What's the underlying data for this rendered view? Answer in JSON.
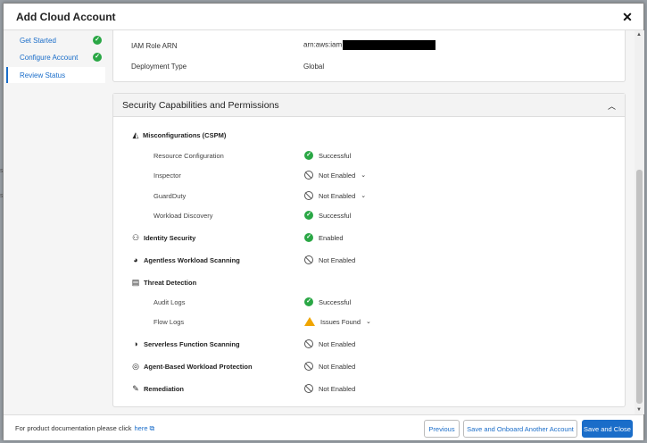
{
  "modal": {
    "title": "Add Cloud Account"
  },
  "sidebar": {
    "items": [
      {
        "label": "Get Started",
        "done": true
      },
      {
        "label": "Configure Account",
        "done": true
      },
      {
        "label": "Review Status",
        "done": false
      }
    ]
  },
  "details": {
    "iam_role_label": "IAM Role ARN",
    "iam_role_value": "arn:aws:iam",
    "deployment_label": "Deployment Type",
    "deployment_value": "Global"
  },
  "capabilities": {
    "title": "Security Capabilities and Permissions",
    "rows": [
      {
        "label": "Misconfigurations (CSPM)",
        "status": ""
      },
      {
        "label": "Resource Configuration",
        "status": "Successful"
      },
      {
        "label": "Inspector",
        "status": "Not Enabled"
      },
      {
        "label": "GuardDuty",
        "status": "Not Enabled"
      },
      {
        "label": "Workload Discovery",
        "status": "Successful"
      },
      {
        "label": "Identity Security",
        "status": "Enabled"
      },
      {
        "label": "Agentless Workload Scanning",
        "status": "Not Enabled"
      },
      {
        "label": "Threat Detection",
        "status": ""
      },
      {
        "label": "Audit Logs",
        "status": "Successful"
      },
      {
        "label": "Flow Logs",
        "status": "Issues Found"
      },
      {
        "label": "Serverless Function Scanning",
        "status": "Not Enabled"
      },
      {
        "label": "Agent-Based Workload Protection",
        "status": "Not Enabled"
      },
      {
        "label": "Remediation",
        "status": "Not Enabled"
      }
    ]
  },
  "footer": {
    "doc_text": "For product documentation please click",
    "doc_link": "here",
    "previous": "Previous",
    "onboard_another": "Save and Onboard Another Account",
    "save_close": "Save and Close"
  },
  "backdrop": {
    "left_chars": [
      "s",
      "s"
    ]
  },
  "colors": {
    "accent": "#1a6dc9",
    "success": "#2aa745",
    "warning": "#f0a500"
  }
}
